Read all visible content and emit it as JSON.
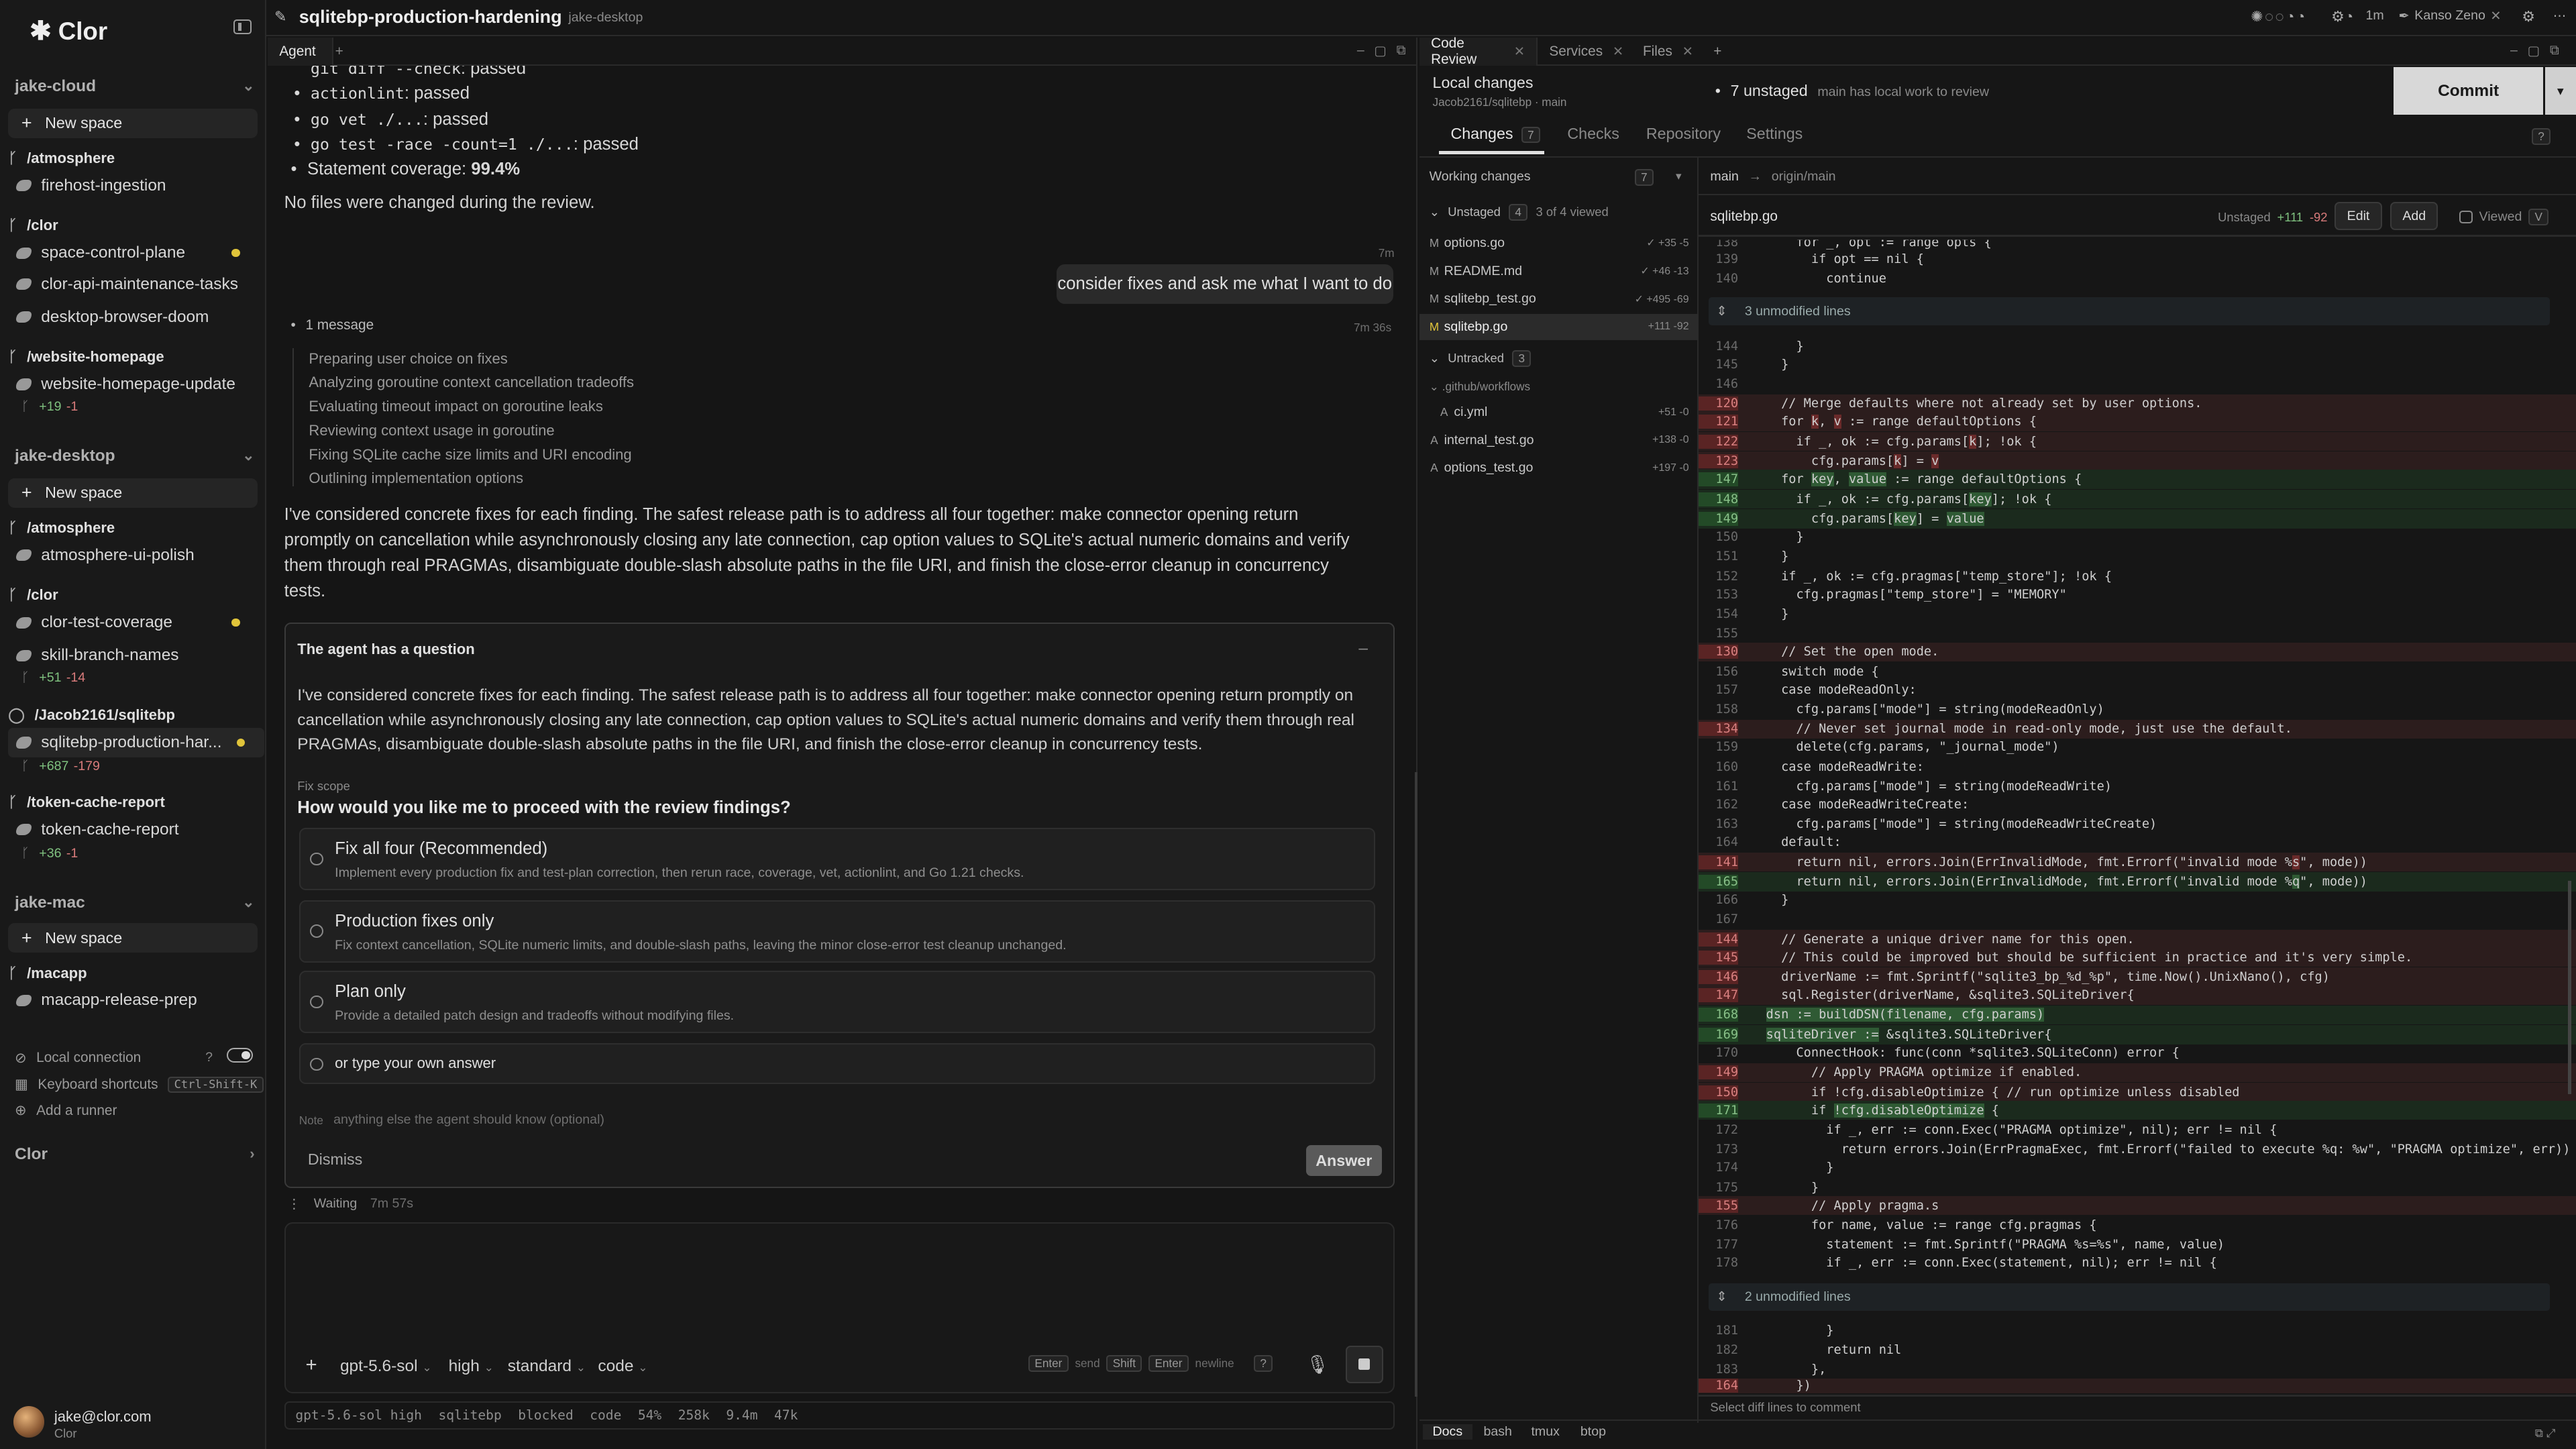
{
  "app": {
    "brand": "Clor",
    "title": "sqlitebp-production-hardening",
    "host": "jake-desktop"
  },
  "topbar_right": {
    "usage": "1m",
    "user": "Kanso Zeno"
  },
  "sidebar": {
    "hosts": [
      {
        "name": "jake-cloud",
        "new_space": "New space",
        "groups": [
          {
            "name": "/atmosphere",
            "spaces": [
              {
                "name": "firehost-ingestion"
              }
            ]
          },
          {
            "name": "/clor",
            "spaces": [
              {
                "name": "space-control-plane"
              },
              {
                "name": "clor-api-maintenance-tasks"
              },
              {
                "name": "desktop-browser-doom"
              }
            ]
          },
          {
            "name": "/website-homepage",
            "spaces": [
              {
                "name": "website-homepage-update",
                "add": "+19",
                "del": "-1"
              }
            ]
          }
        ]
      },
      {
        "name": "jake-desktop",
        "new_space": "New space",
        "groups": [
          {
            "name": "/atmosphere",
            "spaces": [
              {
                "name": "atmosphere-ui-polish"
              }
            ]
          },
          {
            "name": "/clor",
            "spaces": [
              {
                "name": "clor-test-coverage"
              },
              {
                "name": "skill-branch-names",
                "add": "+51",
                "del": "-14"
              }
            ]
          },
          {
            "name": "/Jacob2161/sqlitebp",
            "spaces": [
              {
                "name": "sqlitebp-production-har...",
                "add": "+687",
                "del": "-179"
              }
            ]
          },
          {
            "name": "/token-cache-report",
            "spaces": [
              {
                "name": "token-cache-report",
                "add": "+36",
                "del": "-1"
              }
            ]
          }
        ]
      },
      {
        "name": "jake-mac",
        "new_space": "New space",
        "groups": [
          {
            "name": "/macapp",
            "spaces": [
              {
                "name": "macapp-release-prep"
              }
            ]
          }
        ]
      }
    ],
    "footer": {
      "local_connection": "Local connection",
      "keyboard_shortcuts": "Keyboard shortcuts",
      "shortcut_key": "Ctrl-Shift-K",
      "add_runner": "Add a runner",
      "clor": "Clor"
    },
    "user": {
      "email": "jake@clor.com",
      "org": "Clor"
    }
  },
  "agent": {
    "tab": "Agent",
    "checks": [
      {
        "code": "git diff --check",
        "result": ": passed"
      },
      {
        "code": "actionlint",
        "result": ": passed"
      },
      {
        "code": "go vet ./...",
        "result": ": passed"
      },
      {
        "code": "go test -race -count=1 ./...",
        "result": ": passed"
      }
    ],
    "coverage_label": "Statement coverage: ",
    "coverage_value": "99.4%",
    "no_files": "No files were changed during the review.",
    "user_time": "7m",
    "user_msg": "consider fixes and ask me what I want to do",
    "msg_count": "1 message",
    "msg_time": "7m 36s",
    "steps": [
      "Preparing user choice on fixes",
      "Analyzing goroutine context cancellation tradeoffs",
      "Evaluating timeout impact on goroutine leaks",
      "Reviewing context usage in goroutine",
      "Fixing SQLite cache size limits and URI encoding",
      "Outlining implementation options"
    ],
    "summary": "I've considered concrete fixes for each finding. The safest release path is to address all four together: make connector opening return promptly on cancellation while asynchronously closing any late connection, cap option values to SQLite's actual numeric domains and verify them through real PRAGMAs, disambiguate double-slash absolute paths in the file URI, and finish the close-error cleanup in concurrency tests.",
    "question": {
      "header": "The agent has a question",
      "body": "I've considered concrete fixes for each finding. The safest release path is to address all four together: make connector opening return promptly on cancellation while asynchronously closing any late connection, cap option values to SQLite's actual numeric domains and verify them through real PRAGMAs, disambiguate double-slash absolute paths in the file URI, and finish the close-error cleanup in concurrency tests.",
      "scope_label": "Fix scope",
      "prompt": "How would you like me to proceed with the review findings?",
      "options": [
        {
          "title": "Fix all four (Recommended)",
          "desc": "Implement every production fix and test-plan correction, then rerun race, coverage, vet, actionlint, and Go 1.21 checks."
        },
        {
          "title": "Production fixes only",
          "desc": "Fix context cancellation, SQLite numeric limits, and double-slash paths, leaving the minor close-error test cleanup unchanged."
        },
        {
          "title": "Plan only",
          "desc": "Provide a detailed patch design and tradeoffs without modifying files."
        }
      ],
      "custom_placeholder": "or type your own answer",
      "note_label": "Note",
      "note_placeholder": "anything else the agent should know (optional)",
      "dismiss": "Dismiss",
      "answer": "Answer"
    },
    "waiting": "Waiting",
    "waiting_time": "7m 57s",
    "composer": {
      "model": "gpt-5.6-sol",
      "effort": "high",
      "mode": "standard",
      "tool": "code",
      "hint_enter": "Enter",
      "hint_send": "send",
      "hint_shift": "Shift",
      "hint_enter2": "Enter",
      "hint_newline": "newline",
      "hint_q": "?"
    },
    "status": [
      "gpt-5.6-sol high",
      "sqlitebp",
      "blocked",
      "code",
      "54%",
      "258k",
      "9.4m",
      "47k"
    ]
  },
  "review": {
    "tabs": [
      "Code Review",
      "Services",
      "Files"
    ],
    "local_changes": "Local changes",
    "repo": "Jacob2161/sqlitebp · main",
    "unstaged_count": "7 unstaged",
    "unstaged_note": "main has local work to review",
    "commit": "Commit",
    "subtabs": [
      "Changes",
      "Checks",
      "Repository",
      "Settings"
    ],
    "changes_count": "7",
    "working_changes": "Working changes",
    "working_count": "7",
    "branch_from": "main",
    "branch_to": "origin/main",
    "unstaged_label": "Unstaged",
    "unstaged_num": "4",
    "viewed_note": "3 of 4 viewed",
    "untracked_label": "Untracked",
    "untracked_num": "3",
    "files_unstaged": [
      {
        "st": "M",
        "name": "options.go",
        "counts": "✓ +35 -5"
      },
      {
        "st": "M",
        "name": "README.md",
        "counts": "✓ +46 -13"
      },
      {
        "st": "M",
        "name": "sqlitebp_test.go",
        "counts": "✓ +495 -69"
      },
      {
        "st": "M",
        "name": "sqlitebp.go",
        "counts": "+111 -92"
      }
    ],
    "workflows_dir": ".github/workflows",
    "files_untracked": [
      {
        "st": "A",
        "name": "ci.yml",
        "counts": "+51 -0"
      },
      {
        "st": "A",
        "name": "internal_test.go",
        "counts": "+138 -0"
      },
      {
        "st": "A",
        "name": "options_test.go",
        "counts": "+197 -0"
      }
    ],
    "diff_file": "sqlitebp.go",
    "diff_state": "Unstaged",
    "diff_add": "+111",
    "diff_del": "-92",
    "edit": "Edit",
    "add": "Add",
    "viewed": "Viewed",
    "viewed_key": "V",
    "hunk1": "3 unmodified lines",
    "hunk2": "2 unmodified lines",
    "comment_hint": "Select diff lines to comment",
    "bottom_tabs": [
      "Docs",
      "bash",
      "tmux",
      "btop"
    ]
  }
}
